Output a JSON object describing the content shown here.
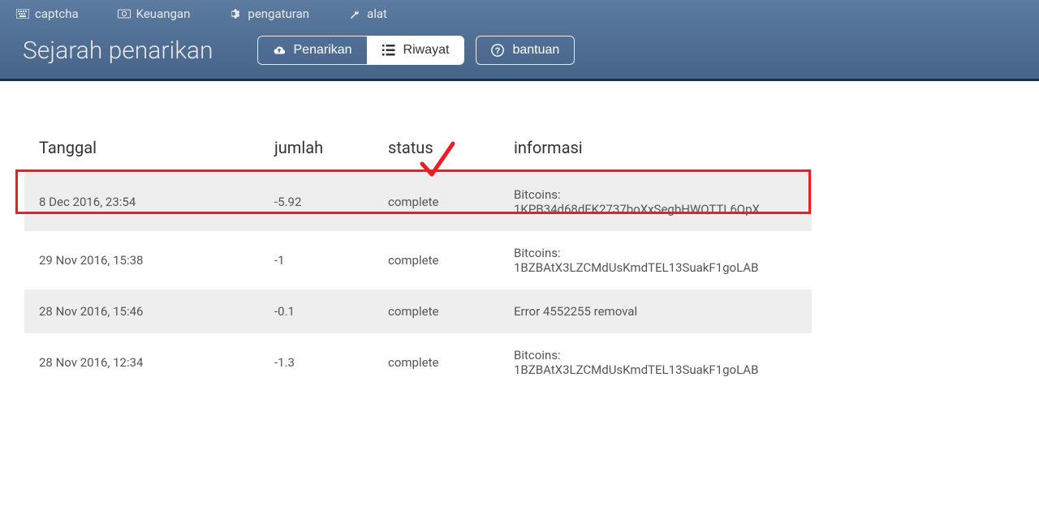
{
  "nav": [
    {
      "label": "captcha",
      "icon": "keyboard-icon"
    },
    {
      "label": "Keuangan",
      "icon": "money-icon"
    },
    {
      "label": "pengaturan",
      "icon": "gear-icon"
    },
    {
      "label": "alat",
      "icon": "wrench-icon"
    }
  ],
  "title": "Sejarah penarikan",
  "buttons": {
    "withdraw": "Penarikan",
    "history": "Riwayat",
    "help": "bantuan"
  },
  "table": {
    "headers": {
      "date": "Tanggal",
      "amount": "jumlah",
      "status": "status",
      "info": "informasi"
    },
    "rows": [
      {
        "date": "8 Dec 2016, 23:54",
        "amount": "-5.92",
        "status": "complete",
        "info": "Bitcoins: 1KPB34d68dFK2737boXxSegbHWQTTL6QpX"
      },
      {
        "date": "29 Nov 2016, 15:38",
        "amount": "-1",
        "status": "complete",
        "info": "Bitcoins: 1BZBAtX3LZCMdUsKmdTEL13SuakF1goLAB"
      },
      {
        "date": "28 Nov 2016, 15:46",
        "amount": "-0.1",
        "status": "complete",
        "info": "Error 4552255 removal"
      },
      {
        "date": "28 Nov 2016, 12:34",
        "amount": "-1.3",
        "status": "complete",
        "info": "Bitcoins: 1BZBAtX3LZCMdUsKmdTEL13SuakF1goLAB"
      }
    ]
  }
}
